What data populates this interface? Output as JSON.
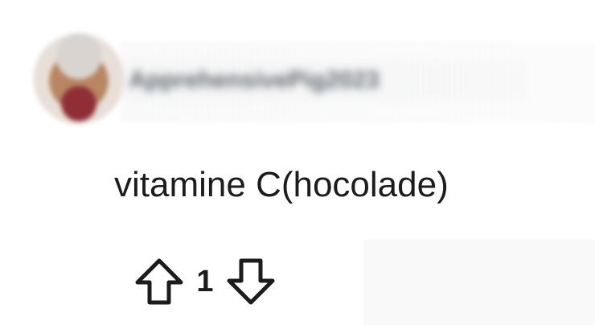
{
  "comment": {
    "author": "ApprehensivePig2023",
    "text": "vitamine C(hocolade)",
    "score": "1"
  },
  "icons": {
    "avatar": "user-avatar",
    "upvote": "up-arrow-icon",
    "downvote": "down-arrow-icon"
  },
  "colors": {
    "text": "#1c1c1c",
    "blur_text": "#5f6670"
  }
}
